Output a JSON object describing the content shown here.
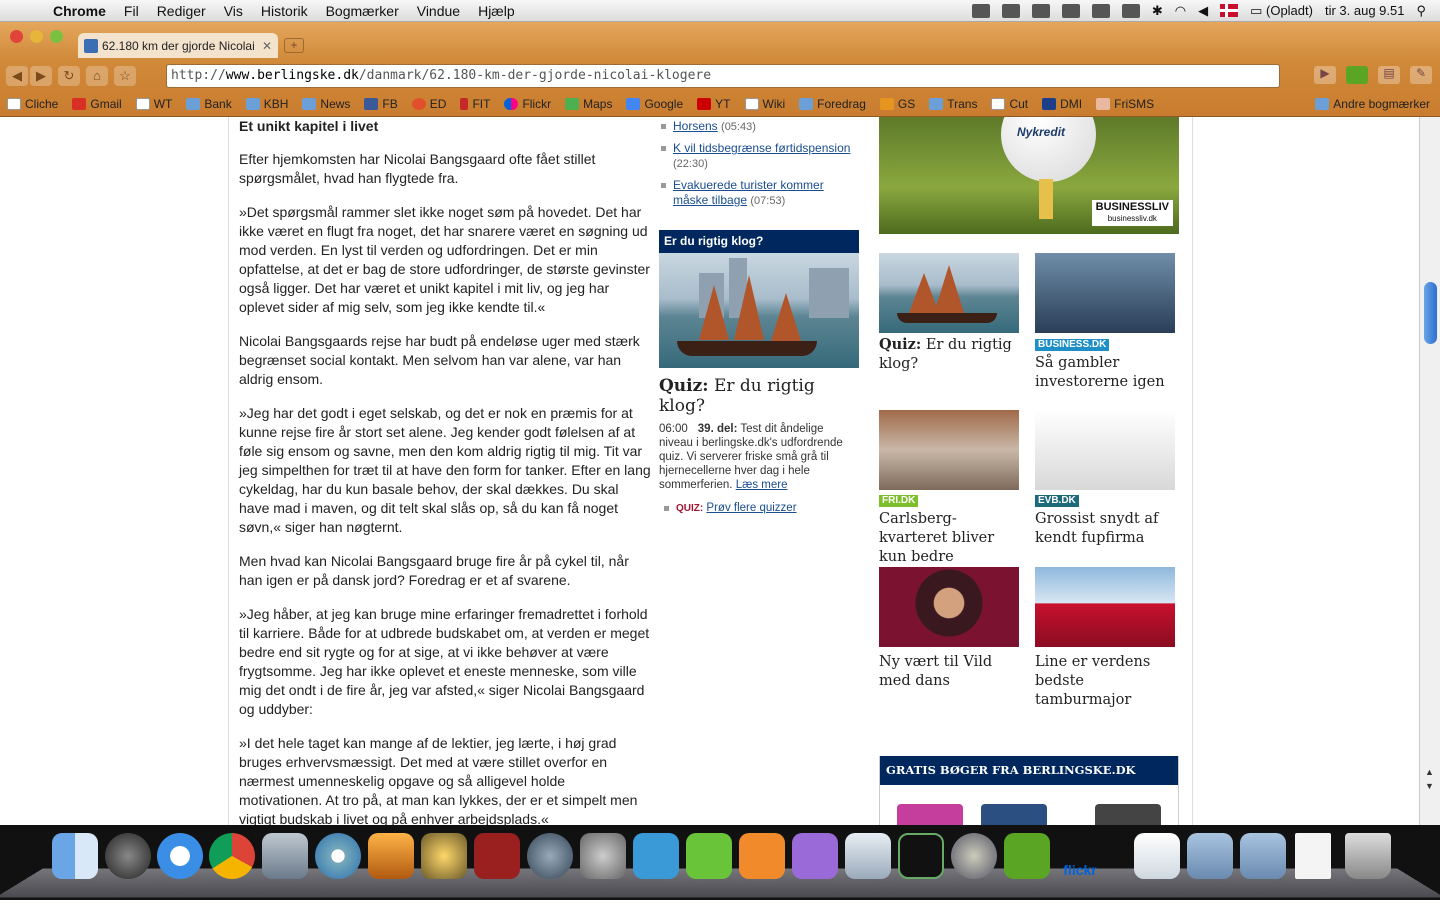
{
  "menubar": {
    "app": "Chrome",
    "items": [
      "Fil",
      "Rediger",
      "Vis",
      "Historik",
      "Bogmærker",
      "Vindue",
      "Hjælp"
    ],
    "battery": "(Opladt)",
    "clock": "tir 3. aug  9.51"
  },
  "browser": {
    "tab_title": "62.180 km der gjorde Nicolai",
    "url_prefix": "http://",
    "url_host": "www.berlingske.dk",
    "url_path": "/danmark/62.180-km-der-gjorde-nicolai-klogere",
    "bookmarks": [
      {
        "label": "Cliche",
        "icon": "page"
      },
      {
        "label": "Gmail",
        "icon": "gmail"
      },
      {
        "label": "WT",
        "icon": "page"
      },
      {
        "label": "Bank",
        "icon": "folder"
      },
      {
        "label": "KBH",
        "icon": "folder"
      },
      {
        "label": "News",
        "icon": "folder"
      },
      {
        "label": "FB",
        "icon": "facebook"
      },
      {
        "label": "ED",
        "icon": "ed"
      },
      {
        "label": "FIT",
        "icon": "fit"
      },
      {
        "label": "Flickr",
        "icon": "flickr"
      },
      {
        "label": "Maps",
        "icon": "maps"
      },
      {
        "label": "Google",
        "icon": "google"
      },
      {
        "label": "YT",
        "icon": "youtube"
      },
      {
        "label": "Wiki",
        "icon": "wiki"
      },
      {
        "label": "Foredrag",
        "icon": "folder"
      },
      {
        "label": "GS",
        "icon": "gs"
      },
      {
        "label": "Trans",
        "icon": "folder"
      },
      {
        "label": "Cut",
        "icon": "page"
      },
      {
        "label": "DMI",
        "icon": "dmi"
      },
      {
        "label": "FriSMS",
        "icon": "frisms"
      }
    ],
    "other_bookmarks": "Andre bogmærker"
  },
  "article": {
    "heading": "Et unikt kapitel i livet",
    "paragraphs": [
      "Efter hjemkomsten har Nicolai Bangsgaard ofte fået stillet spørgsmålet, hvad han flygtede fra.",
      "»Det spørgsmål rammer slet ikke noget søm på hovedet. Det har ikke været en flugt fra noget, det har snarere været en søgning ud mod verden. En lyst til verden og udfordringen. Det er min opfattelse, at det er bag de store udfordringer, de største gevinster også ligger. Det har været et unikt kapitel i mit liv, og jeg har oplevet sider af mig selv, som jeg ikke kendte til.«",
      "Nicolai Bangsgaards rejse har budt på endeløse uger med stærk begrænset social kontakt. Men selvom han var alene, var han aldrig ensom.",
      "»Jeg har det godt i eget selskab, og det er nok en præmis for at kunne rejse fire år stort set alene. Jeg kender godt følelsen af at føle sig ensom og savne, men den kom aldrig rigtig til mig. Tit var jeg simpelthen for træt til at have den form for tanker. Efter en lang cykeldag, har du kun basale behov, der skal dækkes. Du skal have mad i maven, og dit telt skal slås op, så du kan få noget søvn,« siger han nøgternt.",
      "Men hvad kan Nicolai Bangsgaard bruge fire år på cykel til, når han igen er på dansk jord? Foredrag er et af svarene.",
      "»Jeg håber, at jeg kan bruge mine erfaringer fremadrettet i forhold til karriere. Både for at udbrede budskabet om, at verden er meget bedre end sit rygte og for at sige, at vi ikke behøver at være frygtsomme. Jeg har ikke oplevet et eneste menneske, som ville mig det ondt i de fire år, jeg var afsted,« siger Nicolai Bangsgaard og uddyber:",
      "»I det hele taget kan mange af de lektier, jeg lærte, i høj grad bruges erhvervsmæssigt. Det med at være stillet overfor en nærmest umenneskelig opgave og så alligevel holde motivationen. At tro på, at man kan lykkes, der er et simpelt men vigtigt budskab i livet og på enhver arbejdsplads.«"
    ]
  },
  "news": [
    {
      "link": "Horsens",
      "time": "(05:43)"
    },
    {
      "link": "K vil tidsbegrænse førtidspension",
      "time": "(22:30)"
    },
    {
      "link": "Evakuerede turister kommer måske tilbage",
      "time": "(07:53)"
    }
  ],
  "quiz": {
    "header": "Er du rigtig klog?",
    "title_bold": "Quiz:",
    "title_rest": " Er du rigtig klog?",
    "time": "06:00",
    "part": "39. del:",
    "text": " Test dit åndelige niveau i berlingske.dk's udfordrende quiz. Vi serverer friske små grå til hjernecellerne hver dag i hele sommerferien.",
    "read_more": "Læs mere",
    "more_label": "QUIZ:",
    "more_link": "Prøv flere quizzer"
  },
  "ad": {
    "ball_text": "Nykredit",
    "brand": "BUSINESSLIV",
    "brand_url": "businessliv.dk"
  },
  "tiles": [
    {
      "label": "",
      "bold": "Quiz:",
      "caption": " Er du rigtig klog?"
    },
    {
      "label": "BUSINESS.DK",
      "bold": "",
      "caption": "Så gambler investorerne igen"
    },
    {
      "label": "FRI.DK",
      "bold": "",
      "caption": "Carlsberg-kvarteret bliver kun bedre"
    },
    {
      "label": "EVB.DK",
      "bold": "",
      "caption": "Grossist snydt af kendt fupfirma"
    },
    {
      "label": "",
      "bold": "",
      "caption": "Ny vært til Vild med dans"
    },
    {
      "label": "",
      "bold": "",
      "caption": "Line er verdens bedste tamburmajor"
    }
  ],
  "gratis": {
    "header": "GRATIS BØGER FRA BERLINGSKE.DK"
  },
  "dock": {
    "flickr_label": "flickr"
  },
  "colors": {
    "chrome_theme": "#d18a3a",
    "berlingske_blue": "#00285e",
    "link": "#1a4d91",
    "business": "#1f8fc7",
    "fri": "#7cbf2a",
    "evb": "#1d6b7a"
  }
}
